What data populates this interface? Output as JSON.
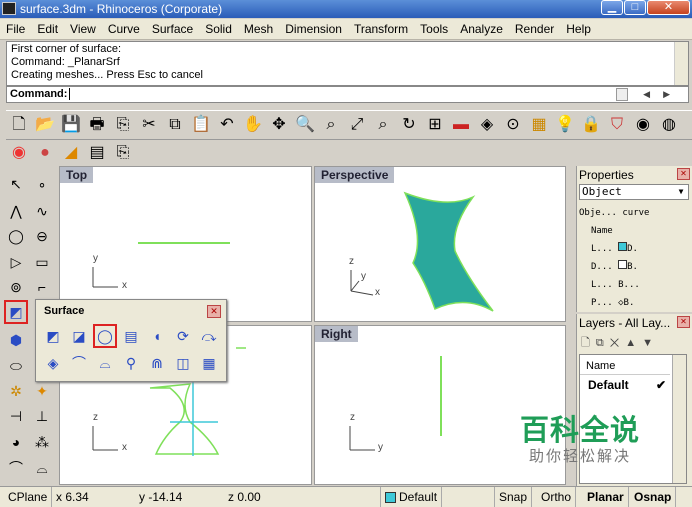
{
  "window": {
    "title": "surface.3dm - Rhinoceros (Corporate)",
    "min": "▁",
    "max": "□",
    "close": "✕"
  },
  "menu": [
    "File",
    "Edit",
    "View",
    "Curve",
    "Surface",
    "Solid",
    "Mesh",
    "Dimension",
    "Transform",
    "Tools",
    "Analyze",
    "Render",
    "Help"
  ],
  "history": [
    "First corner of surface:",
    "Command: _PlanarSrf",
    "Creating meshes... Press Esc to cancel"
  ],
  "command": {
    "label": "Command:",
    "value": ""
  },
  "icons": {
    "toolbar_main": [
      "new-file-icon",
      "open-folder-icon",
      "save-icon",
      "print-icon",
      "import-icon",
      "cut-icon",
      "copy-icon",
      "paste-icon",
      "undo-icon",
      "pan-hand-icon",
      "rotate-view-icon",
      "zoom-icon",
      "zoom-window-icon",
      "zoom-extents-icon",
      "zoom-selected-icon",
      "rotate-icon",
      "four-viewports-icon",
      "car-icon",
      "render-preview-icon",
      "osnap-icon",
      "grid-icon",
      "light-icon",
      "lock-icon",
      "shield-icon",
      "color-wheel-icon",
      "sphere-icon"
    ],
    "toolbar_second": [
      "render-icon",
      "material-icon",
      "environment-icon",
      "layer-icon",
      "properties-icon"
    ],
    "left": [
      "select-arrow-icon",
      "point-icon",
      "polyline-icon",
      "curve-icon",
      "circle-icon",
      "ellipse-icon",
      "polygon-icon",
      "rectangle-icon",
      "offset-icon",
      "fillet-icon",
      "surface-icon",
      "solid-icon",
      "box-icon",
      "cylinder-icon",
      "transform-icon",
      "explode-icon",
      "analyze-icon",
      "dimension-icon",
      "boolean-icon",
      "array-icon",
      "curve-fillet-icon",
      "extend-icon"
    ],
    "surface": [
      "surface-corner-icon",
      "surface-edge-icon",
      "planar-surface-icon",
      "extrude-surface-icon",
      "loft-icon",
      "revolve-icon",
      "rail-revolve-icon",
      "sweep1-icon",
      "sweep2-icon",
      "network-icon",
      "patch-icon",
      "blend-icon",
      "plane-icon",
      "height-field-icon"
    ]
  },
  "viewports": {
    "top": {
      "label": "Top",
      "axis_x": "x",
      "axis_y": "y"
    },
    "perspective": {
      "label": "Perspective",
      "axis_x": "x",
      "axis_y": "y",
      "axis_z": "z"
    },
    "front": {
      "axis_x": "x",
      "axis_z": "z"
    },
    "right": {
      "label": "Right",
      "axis_y": "y",
      "axis_z": "z"
    }
  },
  "surface_panel": {
    "title": "Surface",
    "close": "✕"
  },
  "properties": {
    "title": "Properties",
    "close": "✕",
    "selector": "Object",
    "rows": [
      {
        "label": "Obje...",
        "value": "curve"
      },
      {
        "label": "Name",
        "value": ""
      },
      {
        "label": "L...",
        "value": "D."
      },
      {
        "label": "D...",
        "value": "B."
      },
      {
        "label": "L...",
        "value": "B..."
      },
      {
        "label": "P...",
        "value": "B."
      }
    ]
  },
  "layers": {
    "title": "Layers - All Lay...",
    "close": "✕",
    "column": "Name",
    "rows": [
      {
        "name": "Default",
        "current": "✔"
      }
    ]
  },
  "watermark": {
    "line1": "百科全说",
    "line2": "助你轻松解决"
  },
  "status": {
    "cplane": "CPlane",
    "x": "x 6.34",
    "y": "y -14.14",
    "z": "z 0.00",
    "layer": "Default",
    "snap": "Snap",
    "ortho": "Ortho",
    "planar": "Planar",
    "osnap": "Osnap"
  },
  "colors": {
    "surface_fill": "#2aa89c",
    "curve": "#7fe05a",
    "titlebar": "#2a5cb8",
    "watermark": "#1f9d57"
  }
}
